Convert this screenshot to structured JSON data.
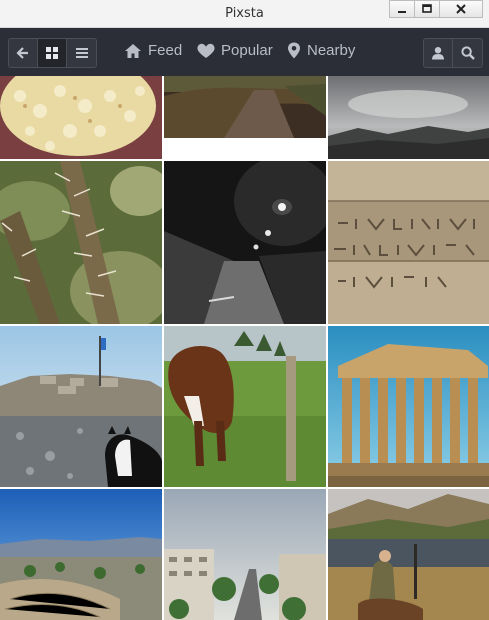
{
  "window": {
    "title": "Pixsta",
    "buttons": [
      "minimize",
      "maximize",
      "close"
    ]
  },
  "toolbar": {
    "left_controls": [
      {
        "name": "back",
        "icon": "arrow-left-icon"
      },
      {
        "name": "grid-view",
        "icon": "grid-icon",
        "active": true
      },
      {
        "name": "list-view",
        "icon": "list-icon"
      }
    ],
    "nav": [
      {
        "label": "Feed",
        "icon": "home-icon"
      },
      {
        "label": "Popular",
        "icon": "heart-icon"
      },
      {
        "label": "Nearby",
        "icon": "location-pin-icon"
      }
    ],
    "right_controls": [
      {
        "name": "profile",
        "icon": "user-icon"
      },
      {
        "name": "search",
        "icon": "search-icon"
      }
    ]
  },
  "photos": [
    {
      "subject": "white flowers"
    },
    {
      "subject": "dirt road"
    },
    {
      "subject": "cloudy mountains"
    },
    {
      "subject": "thorny plant"
    },
    {
      "subject": "night street"
    },
    {
      "subject": "stone inscription"
    },
    {
      "subject": "cat on rocks with flag"
    },
    {
      "subject": "brown cow in field"
    },
    {
      "subject": "parthenon"
    },
    {
      "subject": "city and sea"
    },
    {
      "subject": "city street aerial"
    },
    {
      "subject": "hunter by lake"
    }
  ],
  "colors": {
    "toolbar_bg": "#2b2e36",
    "toolbar_text": "#b9bdc6"
  }
}
